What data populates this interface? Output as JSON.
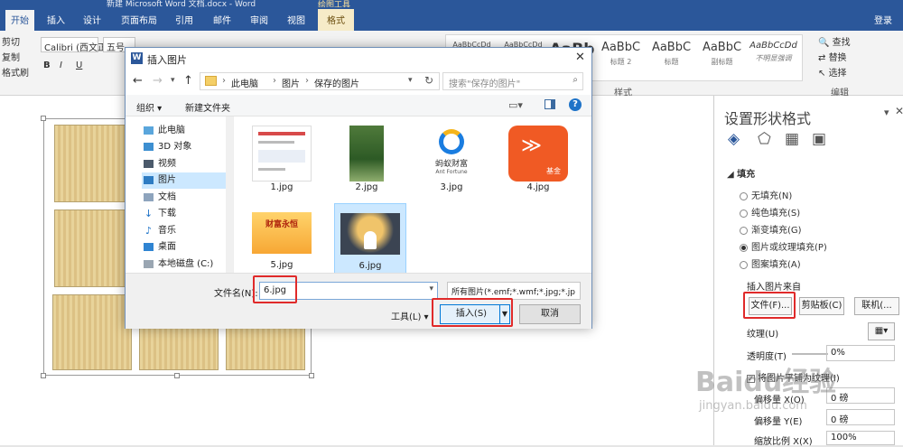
{
  "window": {
    "title": "新建 Microsoft Word 文档.docx - Word",
    "context_title": "绘图工具"
  },
  "tabs": [
    "开始",
    "插入",
    "设计",
    "页面布局",
    "引用",
    "邮件",
    "审阅",
    "视图",
    "格式"
  ],
  "login": "登录",
  "ribbon": {
    "clipboard": {
      "cut": "剪切",
      "copy": "复制",
      "painter": "格式刷"
    },
    "font": {
      "name": "Calibri (西文正",
      "size": "五号"
    },
    "styles": [
      {
        "preview": "AaBbCcDd",
        "name": ""
      },
      {
        "preview": "AaBbCcDd",
        "name": ""
      },
      {
        "preview": "AaBb",
        "name": ""
      },
      {
        "preview": "AaBbC",
        "name": "标题 2"
      },
      {
        "preview": "AaBbC",
        "name": "标题"
      },
      {
        "preview": "AaBbC",
        "name": "副标题"
      },
      {
        "preview": "AaBbCcDd",
        "name": "不明显强调"
      }
    ],
    "styles_group": "样式",
    "editing": {
      "find": "查找",
      "replace": "替换",
      "select": "选择",
      "group": "编辑"
    }
  },
  "pane": {
    "title": "设置形状格式",
    "section": "填充",
    "options": [
      "无填充(N)",
      "纯色填充(S)",
      "渐变填充(G)",
      "图片或纹理填充(P)",
      "图案填充(A)"
    ],
    "selected_option": 3,
    "insert_from": "插入图片来自",
    "buttons": {
      "file": "文件(F)...",
      "clipboard": "剪贴板(C)",
      "online": "联机(..."
    },
    "texture_label": "纹理(U)",
    "transparency_label": "透明度(T)",
    "transparency_value": "0%",
    "tile_label": "将图片平铺为纹理(I)",
    "offset_x_label": "偏移量 X(O)",
    "offset_x_value": "0 磅",
    "offset_y_label": "偏移量 Y(E)",
    "offset_y_value": "0 磅",
    "scale_x_label": "缩放比例 X(X)",
    "scale_x_value": "100%"
  },
  "dialog": {
    "title": "插入图片",
    "breadcrumb": [
      "此电脑",
      "图片",
      "保存的图片"
    ],
    "search_placeholder": "搜索\"保存的图片\"",
    "organize": "组织 ▾",
    "new_folder": "新建文件夹",
    "nav": [
      {
        "label": "此电脑",
        "icon": "computer-icon"
      },
      {
        "label": "3D 对象",
        "icon": "3d-objects-icon"
      },
      {
        "label": "视频",
        "icon": "video-icon"
      },
      {
        "label": "图片",
        "icon": "pictures-icon",
        "selected": true
      },
      {
        "label": "文档",
        "icon": "documents-icon"
      },
      {
        "label": "下载",
        "icon": "download-icon"
      },
      {
        "label": "音乐",
        "icon": "music-icon"
      },
      {
        "label": "桌面",
        "icon": "desktop-icon"
      },
      {
        "label": "本地磁盘 (C:)",
        "icon": "drive-icon"
      }
    ],
    "files": [
      {
        "name": "1.jpg",
        "thumb": "webpage-screenshot"
      },
      {
        "name": "2.jpg",
        "thumb": "green-photo"
      },
      {
        "name": "3.jpg",
        "thumb": "ant-fortune-logo",
        "caption": "蚂蚁财富",
        "caption2": "Ant Fortune"
      },
      {
        "name": "4.jpg",
        "thumb": "fund-app-icon",
        "caption": "基金"
      },
      {
        "name": "5.jpg",
        "thumb": "orange-banner",
        "caption": "财富永恒"
      },
      {
        "name": "6.jpg",
        "thumb": "family-silhouette",
        "selected": true
      }
    ],
    "filename_label": "文件名(N):",
    "filename_value": "6.jpg",
    "filetype_value": "所有图片(*.emf;*.wmf;*.jpg;*.jp",
    "tools_label": "工具(L)",
    "insert_label": "插入(S)",
    "cancel_label": "取消"
  },
  "watermark": {
    "brand": "Baidu经验",
    "url": "jingyan.baidu.com"
  }
}
